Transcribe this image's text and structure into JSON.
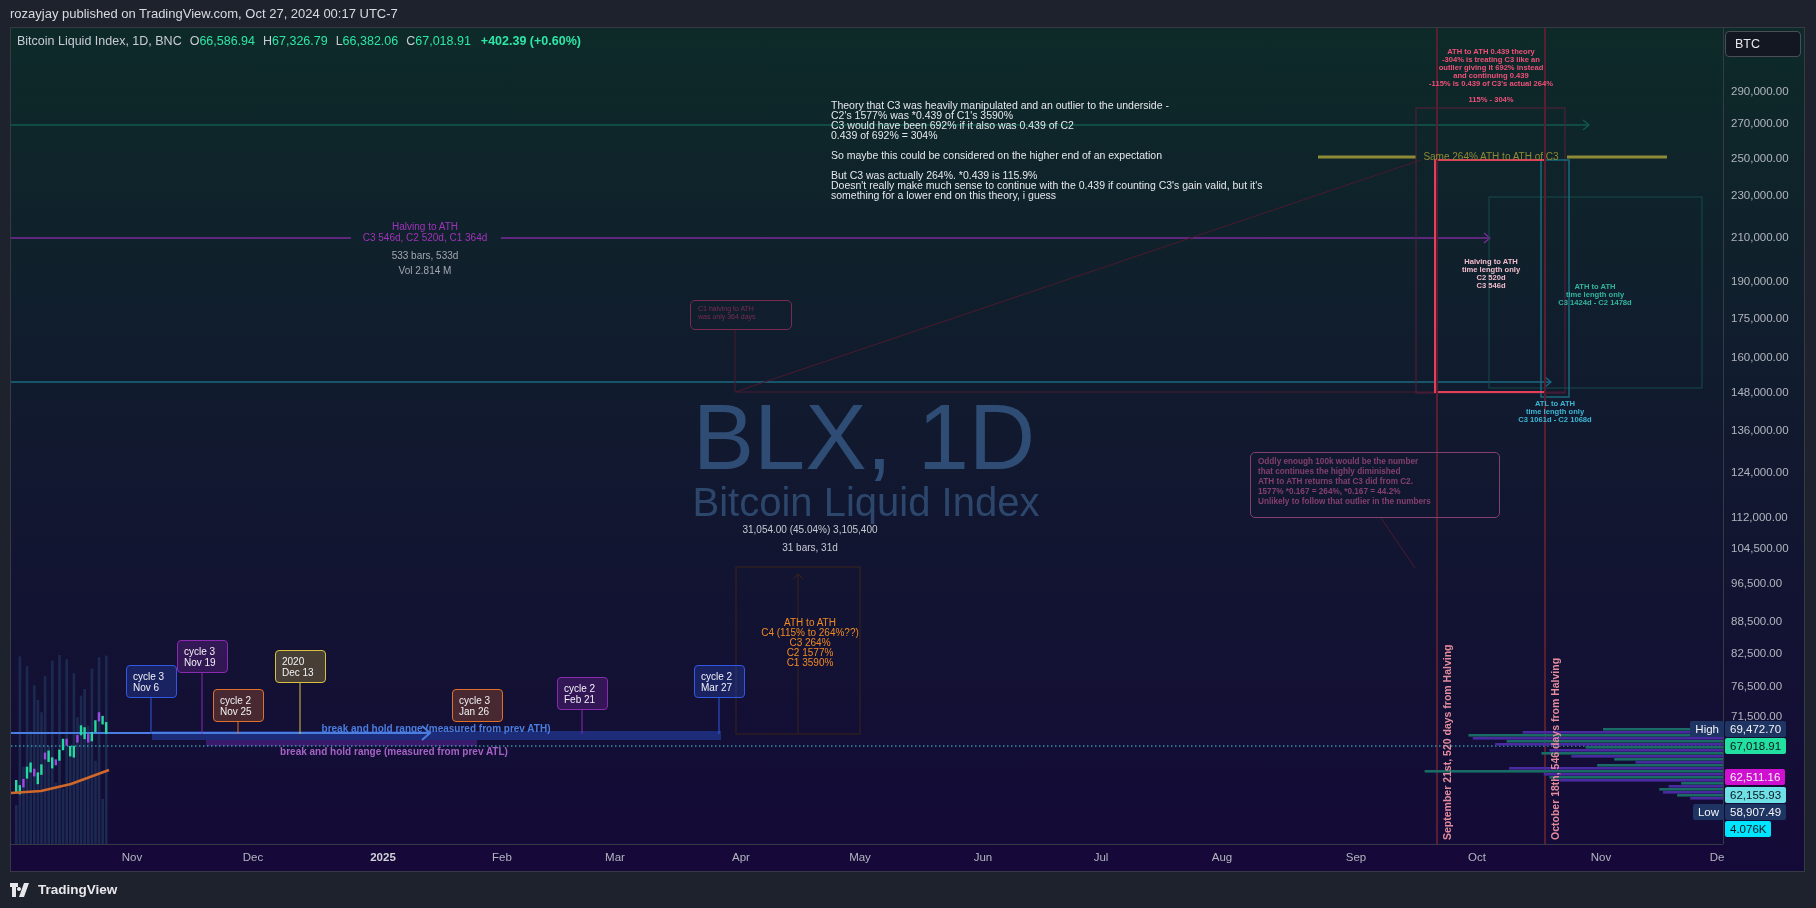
{
  "publisher_line": "rozayjay published on TradingView.com, Oct 27, 2024 00:17 UTC-7",
  "legend": {
    "symbol": "Bitcoin Liquid Index, 1D, BNC",
    "fields": [
      {
        "label": "O",
        "value": "66,586.94"
      },
      {
        "label": "H",
        "value": "67,326.79"
      },
      {
        "label": "L",
        "value": "66,382.06"
      },
      {
        "label": "C",
        "value": "67,018.91"
      }
    ],
    "change": "+402.39 (+0.60%)"
  },
  "currency_button": "BTC",
  "symbol_watermark": {
    "title": "BLX, 1D",
    "subtitle": "Bitcoin Liquid Index"
  },
  "annotations": [
    {
      "kind": "note",
      "text": "Theory that C3 was heavily manipulated and an outlier to the underside -\nC2's 1577% was *0.439 of C1's 3590%\nC3 would have been 692% if it also was 0.439 of C2\n0.439 of 692% = 304%\n\nSo maybe this could be considered on the higher end of an expectation\n\nBut C3 was actually 264%. *0.439 is 115.9%\nDoesn't really make much sense to continue with the 0.439 if counting C3's gain valid, but it's\nsomething for a lower end on this theory, i guess",
      "color": "#e6e7ec"
    },
    {
      "kind": "note",
      "text": "ATH to ATH 0.439 theory\n-304% is treating C3 like an\noutlier giving it 692% instead\nand continuing 0.439\n-115% is 0.439 of C3's actual 264%\n\n115% - 304%",
      "color": "#f0507a"
    },
    {
      "kind": "note",
      "text": "Same 264% ATH to ATH of C3",
      "color": "#8e8a36"
    },
    {
      "kind": "note",
      "text": "Halving to ATH\nC3 546d, C2 520d, C1 364d",
      "color": "#a232bc"
    },
    {
      "kind": "note",
      "text": "533 bars, 533d",
      "color": "#a3a6b2"
    },
    {
      "kind": "note",
      "text": "Vol 2.814 M",
      "color": "#a3a6b2"
    },
    {
      "kind": "callout",
      "text": "C1 halving to ATH\nwas only 364 days",
      "color": "#7a2c50"
    },
    {
      "kind": "note",
      "text": "Halving to ATH\ntime length only\nC2 520d\nC3 546d",
      "color": "#f2bccd"
    },
    {
      "kind": "note",
      "text": "ATH to ATH\ntime length only\nC3 1424d - C2 1478d",
      "color": "#34b49e"
    },
    {
      "kind": "note",
      "text": "ATL to ATH\ntime length only\nC3 1061d - C2 1068d",
      "color": "#3cb6d4"
    },
    {
      "kind": "callout",
      "text": "Oddly enough 100k would be the number\nthat continues the highly diminished\nATH to ATH returns that C3 did from C2.\n1577% *0.167 = 264%, *0.167 = 44.2%\nUnlikely to follow that outlier in the numbers",
      "color": "#84406e"
    },
    {
      "kind": "note",
      "text": "31,054.00 (45.04%) 3,105,400",
      "color": "#c8cad2"
    },
    {
      "kind": "note",
      "text": "31 bars, 31d",
      "color": "#c8cad2"
    },
    {
      "kind": "note",
      "text": "ATH to ATH\nC4 (115% to 264%??)\nC3 264%\nC2 1577%\nC1 3590%",
      "color": "#f08a24"
    },
    {
      "kind": "flag",
      "text": "cycle 3\nNov 6",
      "color": "#3058e0"
    },
    {
      "kind": "flag",
      "text": "cycle 3\nNov 19",
      "color": "#8a2ab0"
    },
    {
      "kind": "flag",
      "text": "cycle 2\nNov 25",
      "color": "#e0702a"
    },
    {
      "kind": "flag",
      "text": "2020\nDec 13",
      "color": "#d8c040"
    },
    {
      "kind": "flag",
      "text": "cycle 3\nJan 26",
      "color": "#e0702a"
    },
    {
      "kind": "flag",
      "text": "cycle 2\nFeb 21",
      "color": "#8a2ab0"
    },
    {
      "kind": "flag",
      "text": "cycle 2\nMar 27",
      "color": "#3058e0"
    },
    {
      "kind": "range_label",
      "text": "break and hold range (measured from prev ATH)",
      "color": "#4a7de0"
    },
    {
      "kind": "range_label",
      "text": "break and hold range (measured from prev ATL)",
      "color": "#a462c4"
    },
    {
      "kind": "vertical",
      "text": "September 21st, 520 days from Halving",
      "color": "#e48c9c"
    },
    {
      "kind": "vertical",
      "text": "October 18th, 546 days from Halving",
      "color": "#e48c9c"
    }
  ],
  "price_axis": {
    "ticks": [
      "290,000.00",
      "270,000.00",
      "250,000.00",
      "230,000.00",
      "210,000.00",
      "190,000.00",
      "175,000.00",
      "160,000.00",
      "148,000.00",
      "136,000.00",
      "124,000.00",
      "112,000.00",
      "104,500.00",
      "96,500.00",
      "88,500.00",
      "82,500.00",
      "76,500.00",
      "71,500.00"
    ],
    "markers": [
      {
        "label": "High",
        "value": "69,472.70",
        "color": "#1e3462"
      },
      {
        "value": "67,018.91",
        "color": "#22e0a0"
      },
      {
        "value": "62,511.16",
        "color": "#d010d0"
      },
      {
        "value": "62,155.93",
        "color": "#6ee0e8"
      },
      {
        "label": "Low",
        "value": "58,907.49",
        "color": "#1e3462"
      },
      {
        "value": "4.076K",
        "color": "#00e5ff"
      }
    ]
  },
  "time_axis": [
    {
      "label": "Nov",
      "kind": "month"
    },
    {
      "label": "Dec",
      "kind": "month"
    },
    {
      "label": "2025",
      "kind": "year"
    },
    {
      "label": "Feb",
      "kind": "month"
    },
    {
      "label": "Mar",
      "kind": "month"
    },
    {
      "label": "Apr",
      "kind": "month"
    },
    {
      "label": "May",
      "kind": "month"
    },
    {
      "label": "Jun",
      "kind": "month"
    },
    {
      "label": "Jul",
      "kind": "month"
    },
    {
      "label": "Aug",
      "kind": "month"
    },
    {
      "label": "Sep",
      "kind": "month"
    },
    {
      "label": "Oct",
      "kind": "month"
    },
    {
      "label": "Nov",
      "kind": "month"
    },
    {
      "label": "De",
      "kind": "month"
    }
  ],
  "footer_logo": "TradingView"
}
